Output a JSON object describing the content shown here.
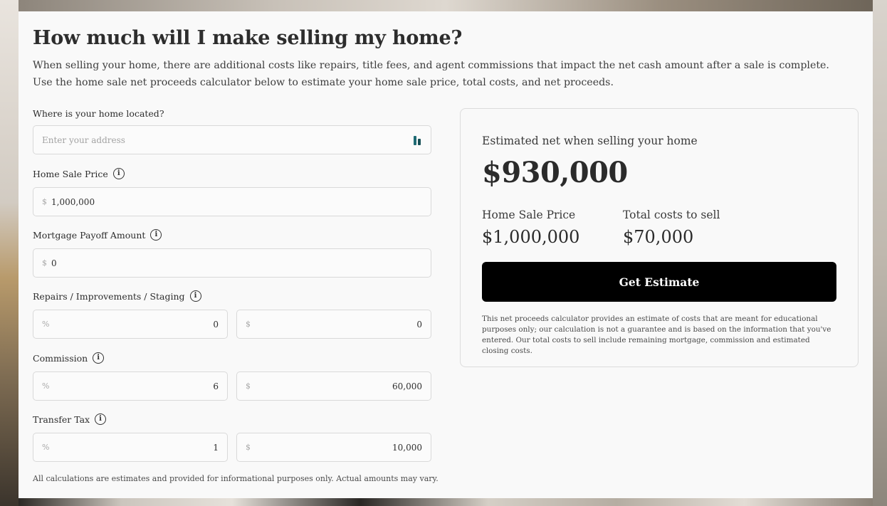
{
  "page": {
    "title": "How much will I make selling my home?",
    "intro": "When selling your home, there are additional costs like repairs, title fees, and agent commissions that impact the net cash amount after a sale is complete. Use the home sale net proceeds calculator below to estimate your home sale price, total costs, and net proceeds.",
    "footnote": "All calculations are estimates and provided for informational purposes only. Actual amounts may vary."
  },
  "form": {
    "address": {
      "label": "Where is your home located?",
      "placeholder": "Enter your address",
      "icon": "map-pin-icon"
    },
    "sale_price": {
      "label": "Home Sale Price",
      "prefix": "$",
      "value": "1,000,000"
    },
    "mortgage": {
      "label": "Mortgage Payoff Amount",
      "prefix": "$",
      "value": "0"
    },
    "repairs": {
      "label": "Repairs / Improvements / Staging",
      "percent_prefix": "%",
      "percent_value": "0",
      "dollar_prefix": "$",
      "dollar_value": "0"
    },
    "commission": {
      "label": "Commission",
      "percent_prefix": "%",
      "percent_value": "6",
      "dollar_prefix": "$",
      "dollar_value": "60,000"
    },
    "transfer_tax": {
      "label": "Transfer Tax",
      "percent_prefix": "%",
      "percent_value": "1",
      "dollar_prefix": "$",
      "dollar_value": "10,000"
    },
    "info_icon_glyph": "i"
  },
  "summary": {
    "eyebrow": "Estimated net when selling your home",
    "net_value": "$930,000",
    "sale_price_label": "Home Sale Price",
    "sale_price_value": "$1,000,000",
    "total_costs_label": "Total costs to sell",
    "total_costs_value": "$70,000",
    "button_label": "Get Estimate",
    "disclaimer": "This net proceeds calculator provides an estimate of costs that are meant for educational purposes only; our calculation is not a guarantee and is based on the information that you've entered. Our total costs to sell include remaining mortgage, commission and estimated closing costs."
  },
  "colors": {
    "button_bg": "#000000",
    "panel_bg": "#f9f9f9",
    "field_border": "#d9d9d9",
    "accent_icon": "#1f6b74"
  }
}
